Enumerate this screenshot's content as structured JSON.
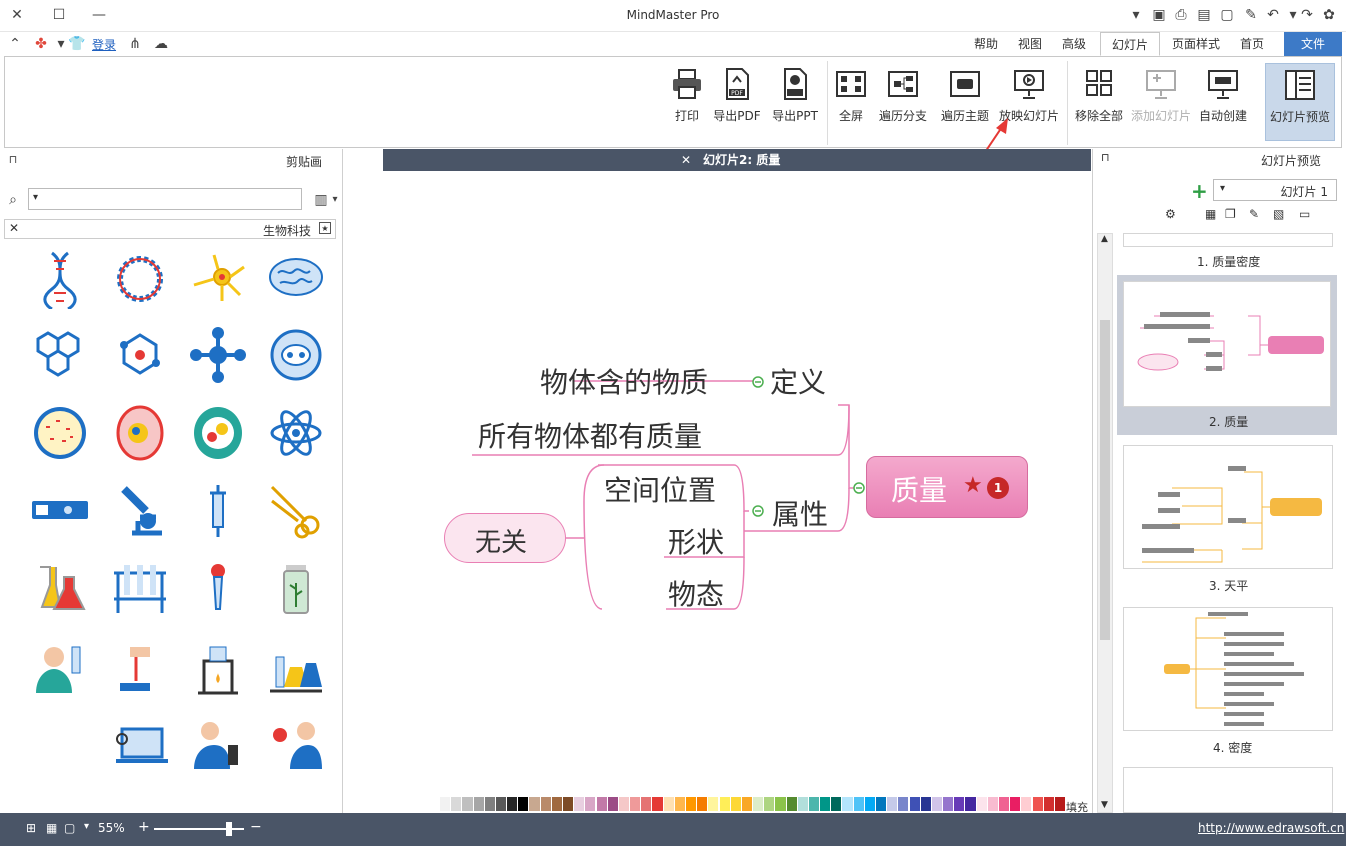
{
  "app": {
    "title": "MindMaster Pro"
  },
  "menu": {
    "file": "文件",
    "tabs": [
      "首页",
      "页面样式",
      "幻灯片",
      "高级",
      "视图",
      "帮助"
    ],
    "login": "登录"
  },
  "ribbon": {
    "buttons": [
      {
        "label": "幻灯片预览",
        "icon": "slide-preview-icon"
      },
      {
        "label": "自动创建",
        "icon": "auto-create-icon"
      },
      {
        "label": "添加幻灯片",
        "icon": "add-slide-icon"
      },
      {
        "label": "移除全部",
        "icon": "remove-all-icon"
      },
      {
        "label": "放映幻灯片",
        "icon": "play-slide-icon"
      },
      {
        "label": "遍历主题",
        "icon": "traverse-topic-icon"
      },
      {
        "label": "遍历分支",
        "icon": "traverse-branch-icon"
      },
      {
        "label": "全屏",
        "icon": "fullscreen-icon"
      },
      {
        "label": "导出PPT",
        "icon": "export-ppt-icon"
      },
      {
        "label": "导出PDF",
        "icon": "export-pdf-icon"
      },
      {
        "label": "打印",
        "icon": "print-icon"
      }
    ]
  },
  "slide_panel": {
    "title": "幻灯片预览",
    "selector_value": "幻灯片 1",
    "slides": [
      {
        "caption": "1. 质量密度"
      },
      {
        "caption": "2. 质量"
      },
      {
        "caption": "3. 天平"
      },
      {
        "caption": "4. 密度"
      }
    ]
  },
  "doc_tab": {
    "label": "幻灯片2: 质量"
  },
  "mindmap": {
    "root": {
      "number": "1",
      "label": "质量"
    },
    "branch1": {
      "label": "定义",
      "child": "物体含的物质"
    },
    "branch1_child2": "所有物体都有质量",
    "branch2": {
      "label": "属性",
      "children": [
        "空间位置",
        "形状",
        "物态"
      ]
    },
    "floating": "无关"
  },
  "clip_panel": {
    "title": "剪贴画",
    "category": "生物科技",
    "search_placeholder": ""
  },
  "status": {
    "url": "http://www.edrawsoft.cn",
    "zoom": "55%",
    "fill_label": "填充"
  },
  "colors": {
    "accent": "#3d7ac7",
    "dark_bar": "#4a5567",
    "root_pink": "#e97fb4",
    "floating_bg": "#fbe5ef",
    "arrow_red": "#e53935"
  }
}
